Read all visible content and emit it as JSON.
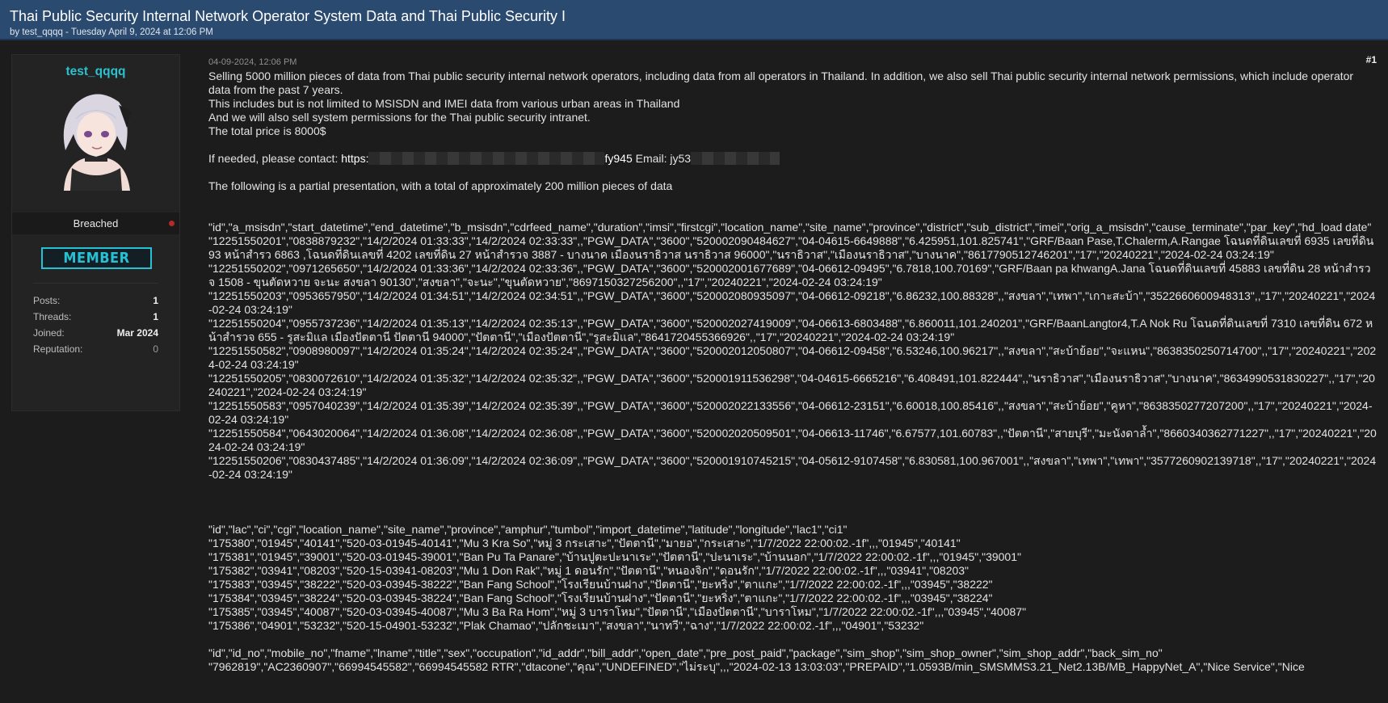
{
  "thread": {
    "title": "Thai Public Security Internal Network Operator System Data and Thai Public Security I",
    "subtitle": "by test_qqqq - Tuesday April 9, 2024 at 12:06 PM"
  },
  "user": {
    "name": "test_qqqq",
    "group": "Breached",
    "rank": "MEMBER",
    "stats": [
      {
        "label": "Posts:",
        "value": "1"
      },
      {
        "label": "Threads:",
        "value": "1"
      },
      {
        "label": "Joined:",
        "value": "Mar 2024"
      },
      {
        "label": "Reputation:",
        "value": "0"
      }
    ]
  },
  "post": {
    "date": "04-09-2024, 12:06 PM",
    "number": "#1",
    "paragraphs": [
      "Selling 5000 million pieces of data from Thai public security internal network operators, including data from all operators in Thailand. In addition, we also sell Thai public security internal network permissions, which include operator data from the past 7 years.",
      "This includes but is not limited to MSISDN and IMEI data from various urban areas in Thailand",
      "And we will also sell system permissions for the Thai public security intranet.",
      "The total price is 8000$"
    ],
    "contact_prefix": "If needed, please contact: ",
    "contact_link_start": "https:",
    "contact_link_end": "fy945",
    "email_label": " Email: jy53",
    "partial_note": "The following is a partial presentation, with a total of approximately 200 million pieces of data",
    "block1": [
      "\"id\",\"a_msisdn\",\"start_datetime\",\"end_datetime\",\"b_msisdn\",\"cdrfeed_name\",\"duration\",\"imsi\",\"firstcgi\",\"location_name\",\"site_name\",\"province\",\"district\",\"sub_district\",\"imei\",\"orig_a_msisdn\",\"cause_terminate\",\"par_key\",\"hd_load date\"",
      "\"12251550201\",\"0838879232\",\"14/2/2024 01:33:33\",\"14/2/2024 02:33:33\",,\"PGW_DATA\",\"3600\",\"520002090484627\",\"04-04615-6649888\",\"6.425951,101.825741\",\"GRF/Baan Pase,T.Chalerm,A.Rangae โฉนดที่ดินเลขที่ 6935 เลขที่ดิน 93  หน้าสำรว 6863 ,โฉนดที่ดินเลขที่ 4202 เลขที่ดิน 27  หน้าสำรวจ 3887 - บางนาค เมืองนราธิวาส นราธิวาส 96000\",\"นราธิวาส\",\"เมืองนราธิวาส\",\"บางนาค\",\"8617790512746201\",\"17\",\"20240221\",\"2024-02-24 03:24:19\"",
      "\"12251550202\",\"0971265650\",\"14/2/2024 01:33:36\",\"14/2/2024 02:33:36\",,\"PGW_DATA\",\"3600\",\"520002001677689\",\"04-06612-09495\",\"6.7818,100.70169\",\"GRF/Baan pa khwangA.Jana โฉนดที่ดินเลขที่ 45883 เลขที่ดิน 28 หน้าสำรวจ 1508 - ขุนตัดหวาย จะนะ สงขลา 90130\",\"สงขลา\",\"จะนะ\",\"ขุนตัดหวาย\",\"8697150327256200\",,\"17\",\"20240221\",\"2024-02-24 03:24:19\"",
      "\"12251550203\",\"0953657950\",\"14/2/2024 01:34:51\",\"14/2/2024 02:34:51\",,\"PGW_DATA\",\"3600\",\"520002080935097\",\"04-06612-09218\",\"6.86232,100.88328\",,\"สงขลา\",\"เทพา\",\"เกาะสะบ้า\",\"3522660600948313\",,\"17\",\"20240221\",\"2024-02-24 03:24:19\"",
      "\"12251550204\",\"0955737236\",\"14/2/2024 01:35:13\",\"14/2/2024 02:35:13\",,\"PGW_DATA\",\"3600\",\"520002027419009\",\"04-06613-6803488\",\"6.860011,101.240201\",\"GRF/BaanLangtor4,T.A Nok Ru โฉนดที่ดินเลขที่ 7310 เลขที่ดิน 672 หน้าสำรวจ 655 - รูสะมิแล เมืองปัตตานี ปัตตานี 94000\",\"ปัตตานี\",\"เมืองปัตตานี\",\"รูสะมิแล\",\"8641720455366926\",,\"17\",\"20240221\",\"2024-02-24 03:24:19\"",
      "\"12251550582\",\"0908980097\",\"14/2/2024 01:35:24\",\"14/2/2024 02:35:24\",,\"PGW_DATA\",\"3600\",\"520002012050807\",\"04-06612-09458\",\"6.53246,100.96217\",,\"สงขลา\",\"สะบ้าย้อย\",\"จะแหน\",\"8638350250714700\",,\"17\",\"20240221\",\"2024-02-24 03:24:19\"",
      "\"12251550205\",\"0830072610\",\"14/2/2024 01:35:32\",\"14/2/2024 02:35:32\",,\"PGW_DATA\",\"3600\",\"520001911536298\",\"04-04615-6665216\",\"6.408491,101.822444\",,\"นราธิวาส\",\"เมืองนราธิวาส\",\"บางนาค\",\"8634990531830227\",,\"17\",\"20240221\",\"2024-02-24 03:24:19\"",
      "\"12251550583\",\"0957040239\",\"14/2/2024 01:35:39\",\"14/2/2024 02:35:39\",,\"PGW_DATA\",\"3600\",\"520002022133556\",\"04-06612-23151\",\"6.60018,100.85416\",,\"สงขลา\",\"สะบ้าย้อย\",\"คูหา\",\"8638350277207200\",,\"17\",\"20240221\",\"2024-02-24 03:24:19\"",
      "\"12251550584\",\"0643020064\",\"14/2/2024 01:36:08\",\"14/2/2024 02:36:08\",,\"PGW_DATA\",\"3600\",\"520002020509501\",\"04-06613-11746\",\"6.67577,101.60783\",,\"ปัตตานี\",\"สายบุรี\",\"มะนังดาล้ำ\",\"8660340362771227\",,\"17\",\"20240221\",\"2024-02-24 03:24:19\"",
      "\"12251550206\",\"0830437485\",\"14/2/2024 01:36:09\",\"14/2/2024 02:36:09\",,\"PGW_DATA\",\"3600\",\"520001910745215\",\"04-05612-9107458\",\"6.830581,100.967001\",,\"สงขลา\",\"เทพา\",\"เทพา\",\"3577260902139718\",,\"17\",\"20240221\",\"2024-02-24 03:24:19\""
    ],
    "block2": [
      "\"id\",\"lac\",\"ci\",\"cgi\",\"location_name\",\"site_name\",\"province\",\"amphur\",\"tumbol\",\"import_datetime\",\"latitude\",\"longitude\",\"lac1\",\"ci1\"",
      "\"175380\",\"01945\",\"40141\",\"520-03-01945-40141\",\"Mu  3 Kra So\",\"หมู่ 3 กระเสาะ\",\"ปัตตานี\",\"มายอ\",\"กระเสาะ\",\"1/7/2022 22:00:02.-1f\",,,\"01945\",\"40141\"",
      "\"175381\",\"01945\",\"39001\",\"520-03-01945-39001\",\"Ban Pu Ta Panare\",\"บ้านปูตะปะนาเระ\",\"ปัตตานี\",\"ปะนาเระ\",\"บ้านนอก\",\"1/7/2022 22:00:02.-1f\",,,\"01945\",\"39001\"",
      "\"175382\",\"03941\",\"08203\",\"520-15-03941-08203\",\"Mu  1 Don Rak\",\"หมู่ 1 ดอนรัก\",\"ปัตตานี\",\"หนองจิก\",\"ดอนรัก\",\"1/7/2022 22:00:02.-1f\",,,\"03941\",\"08203\"",
      "\"175383\",\"03945\",\"38222\",\"520-03-03945-38222\",\"Ban Fang School\",\"โรงเรียนบ้านฝาง\",\"ปัตตานี\",\"ยะหริ่ง\",\"ตาแกะ\",\"1/7/2022 22:00:02.-1f\",,,\"03945\",\"38222\"",
      "\"175384\",\"03945\",\"38224\",\"520-03-03945-38224\",\"Ban Fang School\",\"โรงเรียนบ้านฝาง\",\"ปัตตานี\",\"ยะหริ่ง\",\"ตาแกะ\",\"1/7/2022 22:00:02.-1f\",,,\"03945\",\"38224\"",
      "\"175385\",\"03945\",\"40087\",\"520-03-03945-40087\",\"Mu  3 Ba Ra Hom\",\"หมู่ 3 บาราโหม\",\"ปัตตานี\",\"เมืองปัตตานี\",\"บาราโหม\",\"1/7/2022 22:00:02.-1f\",,,\"03945\",\"40087\"",
      "\"175386\",\"04901\",\"53232\",\"520-15-04901-53232\",\"Plak Chamao\",\"ปลักชะเมา\",\"สงขลา\",\"นาทวี\",\"ฉาง\",\"1/7/2022 22:00:02.-1f\",,,\"04901\",\"53232\""
    ],
    "block3": [
      "\"id\",\"id_no\",\"mobile_no\",\"fname\",\"lname\",\"title\",\"sex\",\"occupation\",\"id_addr\",\"bill_addr\",\"open_date\",\"pre_post_paid\",\"package\",\"sim_shop\",\"sim_shop_owner\",\"sim_shop_addr\",\"back_sim_no\"",
      "\"7962819\",\"AC2360907\",\"66994545582\",\"66994545582 RTR\",\"dtacone\",\"คุณ\",\"UNDEFINED\",\"ไม่ระบุ\",,,\"2024-02-13 13:03:03\",\"PREPAID\",\"1.0593B/min_SMSMMS3.21_Net2.13B/MB_HappyNet_A\",\"Nice Service\",\"Nice"
    ]
  }
}
